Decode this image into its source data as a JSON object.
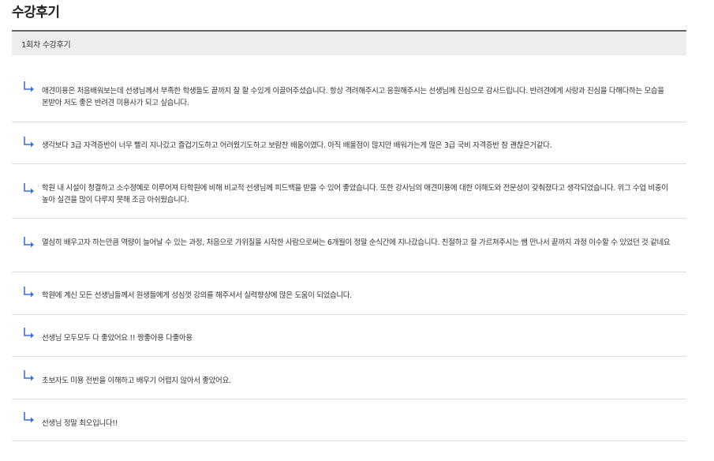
{
  "page": {
    "title": "수강후기"
  },
  "section": {
    "header": "1회차 수강후기"
  },
  "icons": {
    "reply_arrow": "reply-arrow-icon",
    "arrow_color": "#3a6fd8"
  },
  "reviews": [
    {
      "text": "애견미용은 처음배워보는데 선생님께서 부족한 학생들도 끝까지 잘 할 수있게 이끌어주셨습니다. 항상 격려해주시고 응원해주시는 선생님께 진심으로 감사드립니다. 반려견에게 사랑과 진심을 다해다하는 모습을 본받아 저도 좋은 반려견 미용사가 되고 싶습니다."
    },
    {
      "text": "생각보다 3급 자격증반이 너무 빨리 지나갔고 즐겁기도하고 어려웠기도하고 보람찬 배움이였다. 아직 배울점이 많지만 배워가는게 많은 3급 국비 자격증반 참 괜찮은거같다."
    },
    {
      "text": "학원 내 시설이 청결하고 소수정예로 이루어져 타학원에 비해 비교적 선생님께 피드백을 받을 수 있어 좋았습니다. 또한 강사님의 애견미용에 대한 이해도와 전문성이 갖춰졌다고 생각되었습니다. 위그 수업 비중이 높아 실견을 많이 다루지 못해 조금 아쉬웠습니다."
    },
    {
      "text": "열심히 배우고자 하는만큼 역량이 늘어날 수 있는 과정, 처음으로 가위질을 시작한 사람으로써는 6개월이 정말 순식간에 지나갔습니다. 친절하고 잘 가르쳐주시는 쌤 만나서 끝까지 과정 이수할 수 있었던 것 같네요"
    },
    {
      "text": "학원에 계신 모든 선생님들께서 원생들에게 성심껏 강의를 해주셔서 실력향상에 많은 도움이 되었습니다."
    },
    {
      "text": "선생님 모두모두 다 좋았어요 !! 짱좋아용 다좋아용"
    },
    {
      "text": "초보자도 미용 전반을 이해하고 배우기 어렵지 않아서 좋았어요."
    },
    {
      "text": "선생님 정말 최오입니다!!"
    }
  ]
}
